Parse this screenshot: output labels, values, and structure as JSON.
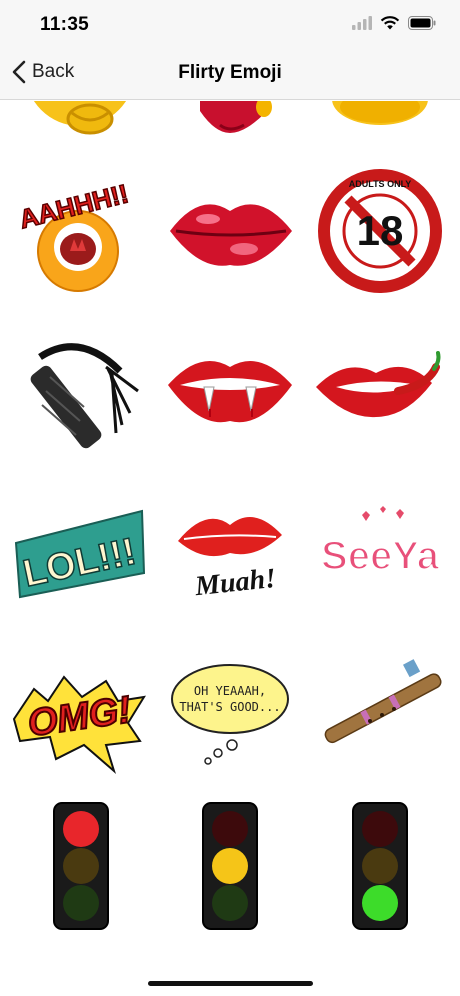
{
  "status_bar": {
    "time": "11:35",
    "icons": [
      "cellular-signal-icon",
      "wifi-icon",
      "battery-icon"
    ]
  },
  "nav_bar": {
    "back_label": "Back",
    "title": "Flirty Emoji"
  },
  "stickers": [
    {
      "name": "partial-emoji-face-sticker"
    },
    {
      "name": "partial-heart-sticker"
    },
    {
      "name": "partial-yellow-face-sticker"
    },
    {
      "name": "aahhh-screaming-face-sticker",
      "text": "AAHHH!!"
    },
    {
      "name": "red-lips-sticker"
    },
    {
      "name": "adults-only-18-sticker",
      "text_number": "18",
      "ring_text": "ADULTS ONLY"
    },
    {
      "name": "black-whip-sticker"
    },
    {
      "name": "vampire-lips-sticker"
    },
    {
      "name": "lips-chili-pepper-sticker"
    },
    {
      "name": "lol-sticker",
      "text": "LOL!!!"
    },
    {
      "name": "kiss-muah-sticker",
      "text": "Muah!"
    },
    {
      "name": "seeya-sticker",
      "text": "SeeYa"
    },
    {
      "name": "omg-sticker",
      "text": "OMG!"
    },
    {
      "name": "oh-yeaaah-speech-bubble-sticker",
      "line1": "OH YEAAAH,",
      "line2": "THAT'S GOOD..."
    },
    {
      "name": "wooden-flute-sticker"
    },
    {
      "name": "traffic-light-red-sticker",
      "active": "red"
    },
    {
      "name": "traffic-light-yellow-sticker",
      "active": "yellow"
    },
    {
      "name": "traffic-light-green-sticker",
      "active": "green"
    }
  ],
  "colors": {
    "nav_background": "#f7f7f7",
    "light_red": "#e8262b",
    "light_yellow": "#f5c518",
    "light_green": "#3ddc2a"
  }
}
